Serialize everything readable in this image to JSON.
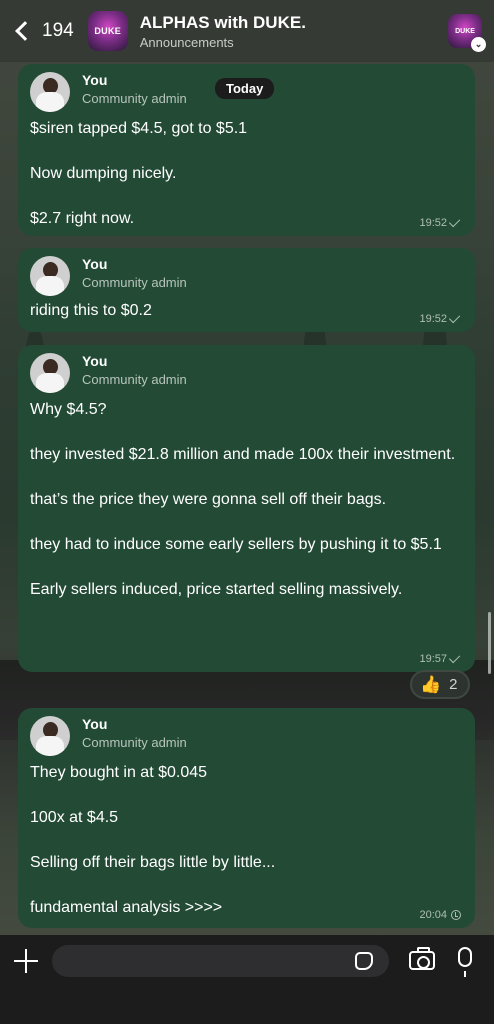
{
  "header": {
    "back_count": "194",
    "group_avatar_text": "DUKE",
    "title": "ALPHAS with DUKE.",
    "subtitle": "Announcements"
  },
  "date_pill": "Today",
  "messages": [
    {
      "sender": "You",
      "role": "Community admin",
      "lines": [
        "$siren tapped $4.5, got to $5.1",
        "",
        "Now dumping nicely.",
        "",
        "$2.7 right now."
      ],
      "time": "19:52",
      "status": "sent"
    },
    {
      "sender": "You",
      "role": "Community admin",
      "lines": [
        "riding this to $0.2"
      ],
      "time": "19:52",
      "status": "sent"
    },
    {
      "sender": "You",
      "role": "Community admin",
      "lines": [
        "Why $4.5?",
        "",
        "they invested $21.8 million and made 100x their investment.",
        "",
        "that’s the price they were gonna sell off their bags.",
        "",
        "they had to induce some early sellers by pushing it to $5.1",
        "",
        "Early sellers induced, price started selling massively."
      ],
      "time": "19:57",
      "status": "sent",
      "reaction": {
        "emoji": "👍",
        "count": "2"
      }
    },
    {
      "sender": "You",
      "role": "Community admin",
      "lines": [
        "They bought in at $0.045",
        "",
        "100x at $4.5",
        "",
        "Selling off their bags little by little...",
        "",
        "fundamental analysis >>>>"
      ],
      "time": "20:04",
      "status": "pending"
    }
  ],
  "composer": {
    "placeholder": ""
  },
  "colors": {
    "bubble": "#234a35",
    "composer_bg": "#1c1c1d"
  }
}
